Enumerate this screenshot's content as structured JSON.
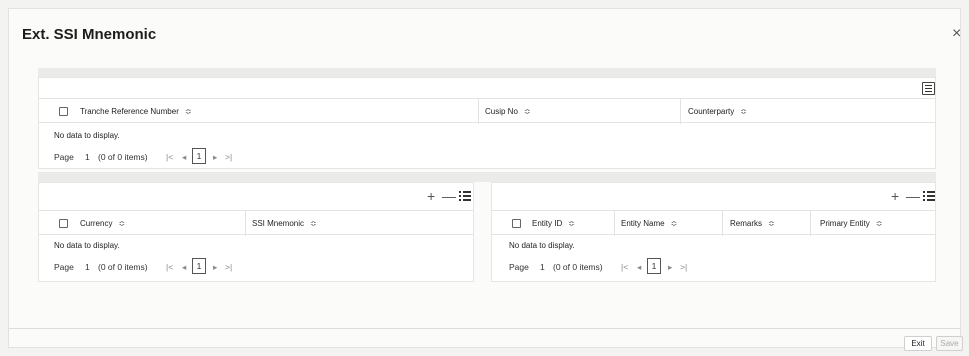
{
  "window": {
    "title": "Ext. SSI Mnemonic",
    "close_glyph": "×"
  },
  "top_grid": {
    "columns": [
      "Tranche Reference Number",
      "Cusip No",
      "Counterparty"
    ],
    "sort_glyph": "≎",
    "empty_text": "No data to display.",
    "pager": {
      "label": "Page",
      "page_input": "1",
      "items_text": "(0 of 0 items)",
      "first": "|<",
      "prev": "◂",
      "current": "1",
      "next": "▸",
      "last": ">|"
    }
  },
  "left_grid": {
    "columns": [
      "Currency",
      "SSI Mnemonic"
    ],
    "add_glyph": "+",
    "remove_glyph": "—",
    "empty_text": "No data to display.",
    "pager": {
      "label": "Page",
      "page_input": "1",
      "items_text": "(0 of 0 items)",
      "first": "|<",
      "prev": "◂",
      "current": "1",
      "next": "▸",
      "last": ">|"
    }
  },
  "right_grid": {
    "columns": [
      "Entity ID",
      "Entity Name",
      "Remarks",
      "Primary Entity"
    ],
    "add_glyph": "+",
    "remove_glyph": "—",
    "empty_text": "No data to display.",
    "pager": {
      "label": "Page",
      "page_input": "1",
      "items_text": "(0 of 0 items)",
      "first": "|<",
      "prev": "◂",
      "current": "1",
      "next": "▸",
      "last": ">|"
    }
  },
  "footer": {
    "exit_label": "Exit",
    "save_label": "Save"
  }
}
